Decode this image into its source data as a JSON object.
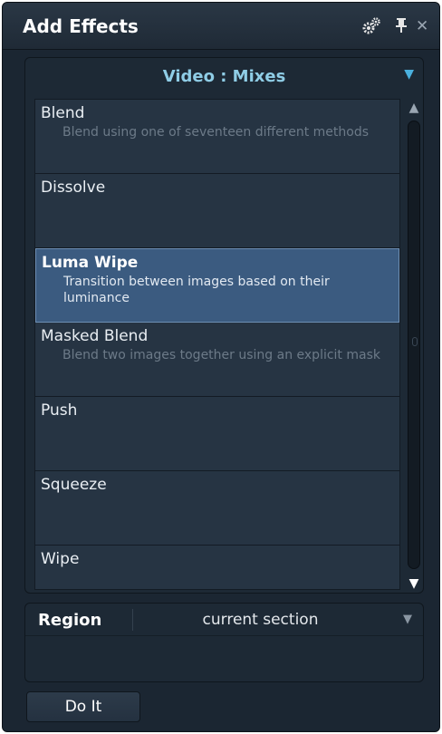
{
  "window": {
    "title": "Add Effects",
    "icons": {
      "gear": "gears-icon",
      "pin": "pin-icon",
      "close": "close-icon"
    }
  },
  "category_dropdown": {
    "value": "Video : Mixes"
  },
  "effects": [
    {
      "name": "Blend",
      "description": "Blend using one of seventeen different methods"
    },
    {
      "name": "Dissolve",
      "description": ""
    },
    {
      "name": "Luma Wipe",
      "description": "Transition between images based on their luminance"
    },
    {
      "name": "Masked Blend",
      "description": "Blend two images together using an explicit mask"
    },
    {
      "name": "Push",
      "description": ""
    },
    {
      "name": "Squeeze",
      "description": ""
    },
    {
      "name": "Wipe",
      "description": ""
    }
  ],
  "selected_effect": "Luma Wipe",
  "region": {
    "label": "Region",
    "value": "current section"
  },
  "action_button": {
    "label": "Do It"
  },
  "colors": {
    "panel_background": "#1b2632",
    "list_background": "#263443",
    "selection": "#3b5b80",
    "dropdown_text": "#8fcde6"
  }
}
